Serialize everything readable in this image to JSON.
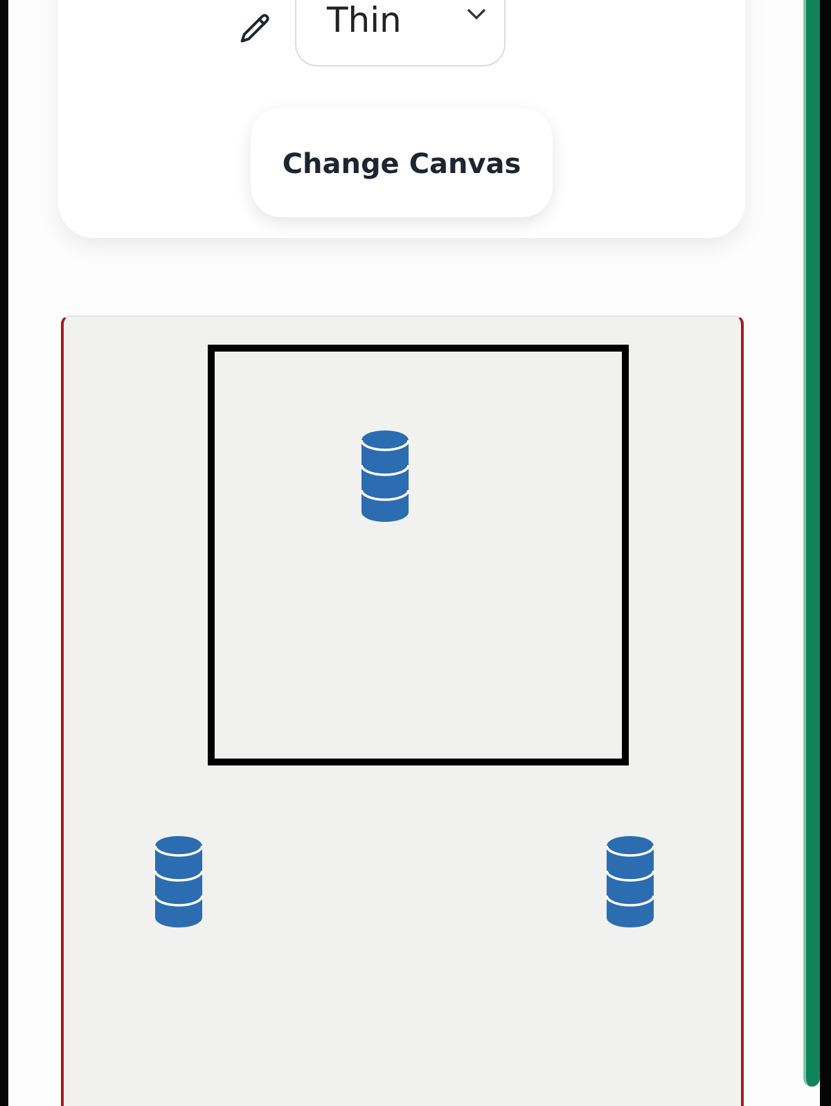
{
  "toolbar": {
    "stroke_select": {
      "value": "Thin"
    }
  },
  "change_canvas_button": {
    "label": "Change Canvas"
  },
  "canvas": {
    "items": [
      {
        "kind": "frame"
      },
      {
        "kind": "database"
      },
      {
        "kind": "database"
      },
      {
        "kind": "database"
      }
    ]
  }
}
